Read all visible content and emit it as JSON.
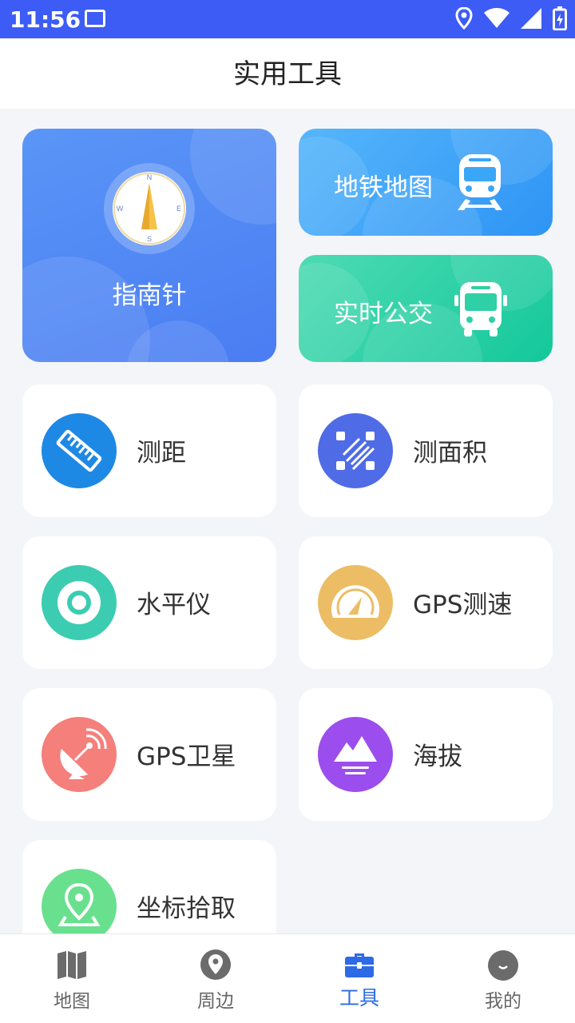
{
  "status_bar": {
    "time": "11:56",
    "icons": [
      "image-icon",
      "location-icon",
      "wifi-icon",
      "signal-icon",
      "battery-icon"
    ]
  },
  "app_bar": {
    "title": "实用工具"
  },
  "feature_cards": {
    "compass": {
      "label": "指南针",
      "icon": "compass-icon",
      "color": "#4a86f5"
    },
    "metro": {
      "label": "地铁地图",
      "icon": "train-icon",
      "color": "#3aa6f8"
    },
    "bus": {
      "label": "实时公交",
      "icon": "bus-icon",
      "color": "#2fd0a6"
    }
  },
  "tools": [
    {
      "label": "测距",
      "icon": "ruler-icon",
      "color": "#1e88e5"
    },
    {
      "label": "测面积",
      "icon": "area-icon",
      "color": "#4f6be6"
    },
    {
      "label": "水平仪",
      "icon": "level-icon",
      "color": "#3cccb2"
    },
    {
      "label": "GPS测速",
      "icon": "speedometer-icon",
      "color": "#ecbd64"
    },
    {
      "label": "GPS卫星",
      "icon": "satellite-icon",
      "color": "#f47f7b"
    },
    {
      "label": "海拔",
      "icon": "mountain-icon",
      "color": "#9c4ded"
    },
    {
      "label": "坐标拾取",
      "icon": "location-pin-icon",
      "color": "#69e08d"
    }
  ],
  "bottom_nav": {
    "active_color": "#2d6ae5",
    "items": [
      {
        "label": "地图",
        "icon": "map-icon",
        "active": false
      },
      {
        "label": "周边",
        "icon": "nearby-icon",
        "active": false
      },
      {
        "label": "工具",
        "icon": "toolbox-icon",
        "active": true
      },
      {
        "label": "我的",
        "icon": "profile-icon",
        "active": false
      }
    ]
  }
}
